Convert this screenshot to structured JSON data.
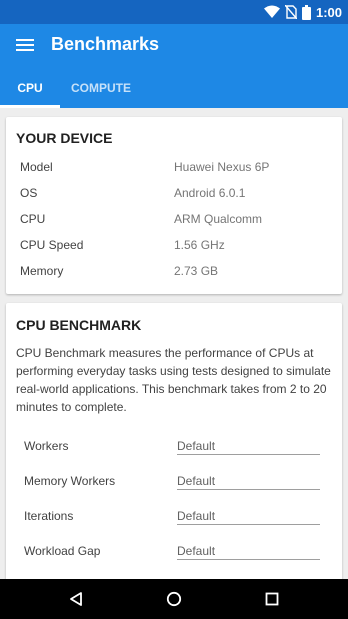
{
  "status_bar": {
    "time": "1:00",
    "icons": [
      "wifi-icon",
      "no-sim-icon",
      "battery-icon"
    ]
  },
  "app_bar": {
    "title": "Benchmarks",
    "menu_icon": "hamburger-menu-icon"
  },
  "tabs": [
    {
      "label": "CPU",
      "selected": true
    },
    {
      "label": "COMPUTE",
      "selected": false
    }
  ],
  "device_card": {
    "title": "YOUR DEVICE",
    "rows": [
      {
        "label": "Model",
        "value": "Huawei Nexus 6P"
      },
      {
        "label": "OS",
        "value": "Android 6.0.1"
      },
      {
        "label": "CPU",
        "value": "ARM Qualcomm"
      },
      {
        "label": "CPU Speed",
        "value": "1.56 GHz"
      },
      {
        "label": "Memory",
        "value": "2.73 GB"
      }
    ]
  },
  "benchmark_card": {
    "title": "CPU BENCHMARK",
    "description": "CPU Benchmark measures the performance of CPUs at performing everyday tasks using tests designed to simulate real-world applications. This benchmark takes from 2 to 20 minutes to complete.",
    "fields": [
      {
        "label": "Workers",
        "value": "Default"
      },
      {
        "label": "Memory Workers",
        "value": "Default"
      },
      {
        "label": "Iterations",
        "value": "Default"
      },
      {
        "label": "Workload Gap",
        "value": "Default"
      }
    ]
  },
  "nav_bar": {
    "icons": [
      "back-icon",
      "home-icon",
      "recents-icon"
    ]
  },
  "colors": {
    "primary": "#1e88e5",
    "primary_dark": "#1565c0",
    "background": "#eeeeee"
  }
}
